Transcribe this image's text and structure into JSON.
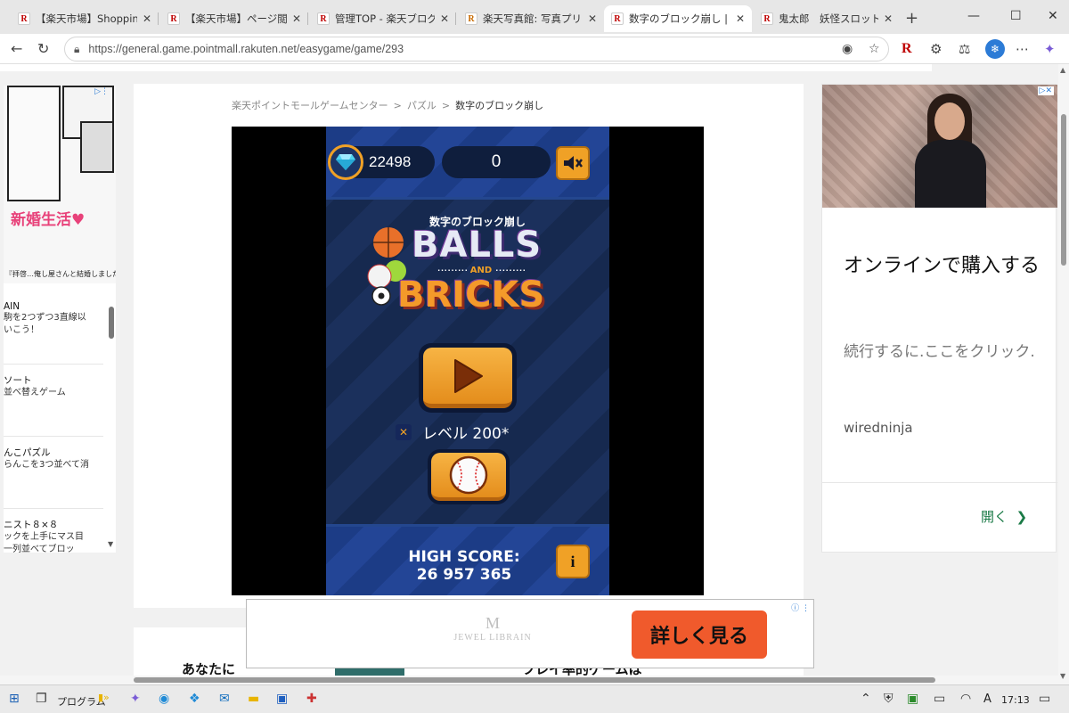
{
  "tabs": [
    {
      "label": "【楽天市場】Shopping is E",
      "active": false
    },
    {
      "label": "【楽天市場】ページ閲覧履",
      "active": false
    },
    {
      "label": "管理TOP - 楽天ブログ",
      "active": false
    },
    {
      "label": "楽天写真館: 写真プリント|",
      "active": false
    },
    {
      "label": "数字のブロック崩し | 楽天",
      "active": true
    },
    {
      "label": "鬼太郎　妖怪スロット | ス",
      "active": false
    }
  ],
  "address": {
    "url": "https://general.game.pointmall.rakuten.net/easygame/game/293"
  },
  "breadcrumb": {
    "home": "楽天ポイントモールゲームセンター",
    "category": "パズル",
    "current": "数字のブロック崩し",
    "sep": ">"
  },
  "game": {
    "gems": "22498",
    "score": "0",
    "subtitle": "数字のブロック崩し",
    "logo_balls": "BALLS",
    "logo_and": "AND",
    "logo_bricks": "BRICKS",
    "level": "レベル 200*",
    "high_score_label": "HIGH SCORE:",
    "high_score": "26 957 365",
    "info_label": "i"
  },
  "left_ad": {
    "headline": "新婚生活♥",
    "caption": "『拝啓…俺し屋さんと結婚しました』"
  },
  "left_list": [
    {
      "title": "AIN",
      "desc1": "駒を2つずつ3直線以",
      "desc2": "いこう！"
    },
    {
      "title": "ソート",
      "desc1": "並べ替えゲーム",
      "desc2": ""
    },
    {
      "title": "んこパズル",
      "desc1": "らんこを3つ並べて消",
      "desc2": ""
    },
    {
      "title": "ニスト８×８",
      "desc1": "ックを上手にマス目",
      "desc2": "一列並べてブロッ"
    }
  ],
  "right_ad": {
    "headline": "オンラインで購入する",
    "sub": "続行するに.ここをクリック.",
    "source": "wiredninja",
    "open": "開く"
  },
  "bottom_ad": {
    "brand_mark": "M",
    "brand": "JEWEL LIBRAIN",
    "cta": "詳しく見る"
  },
  "below": {
    "left": "あなたに",
    "right": "フレイ率的ゲームは"
  },
  "taskbar": {
    "program_label": "プログラム",
    "time": "17:13",
    "ime": "A"
  },
  "colors": {
    "accent": "#f0a126",
    "rakuten_red": "#bf0000",
    "cta": "#f05a2c"
  }
}
